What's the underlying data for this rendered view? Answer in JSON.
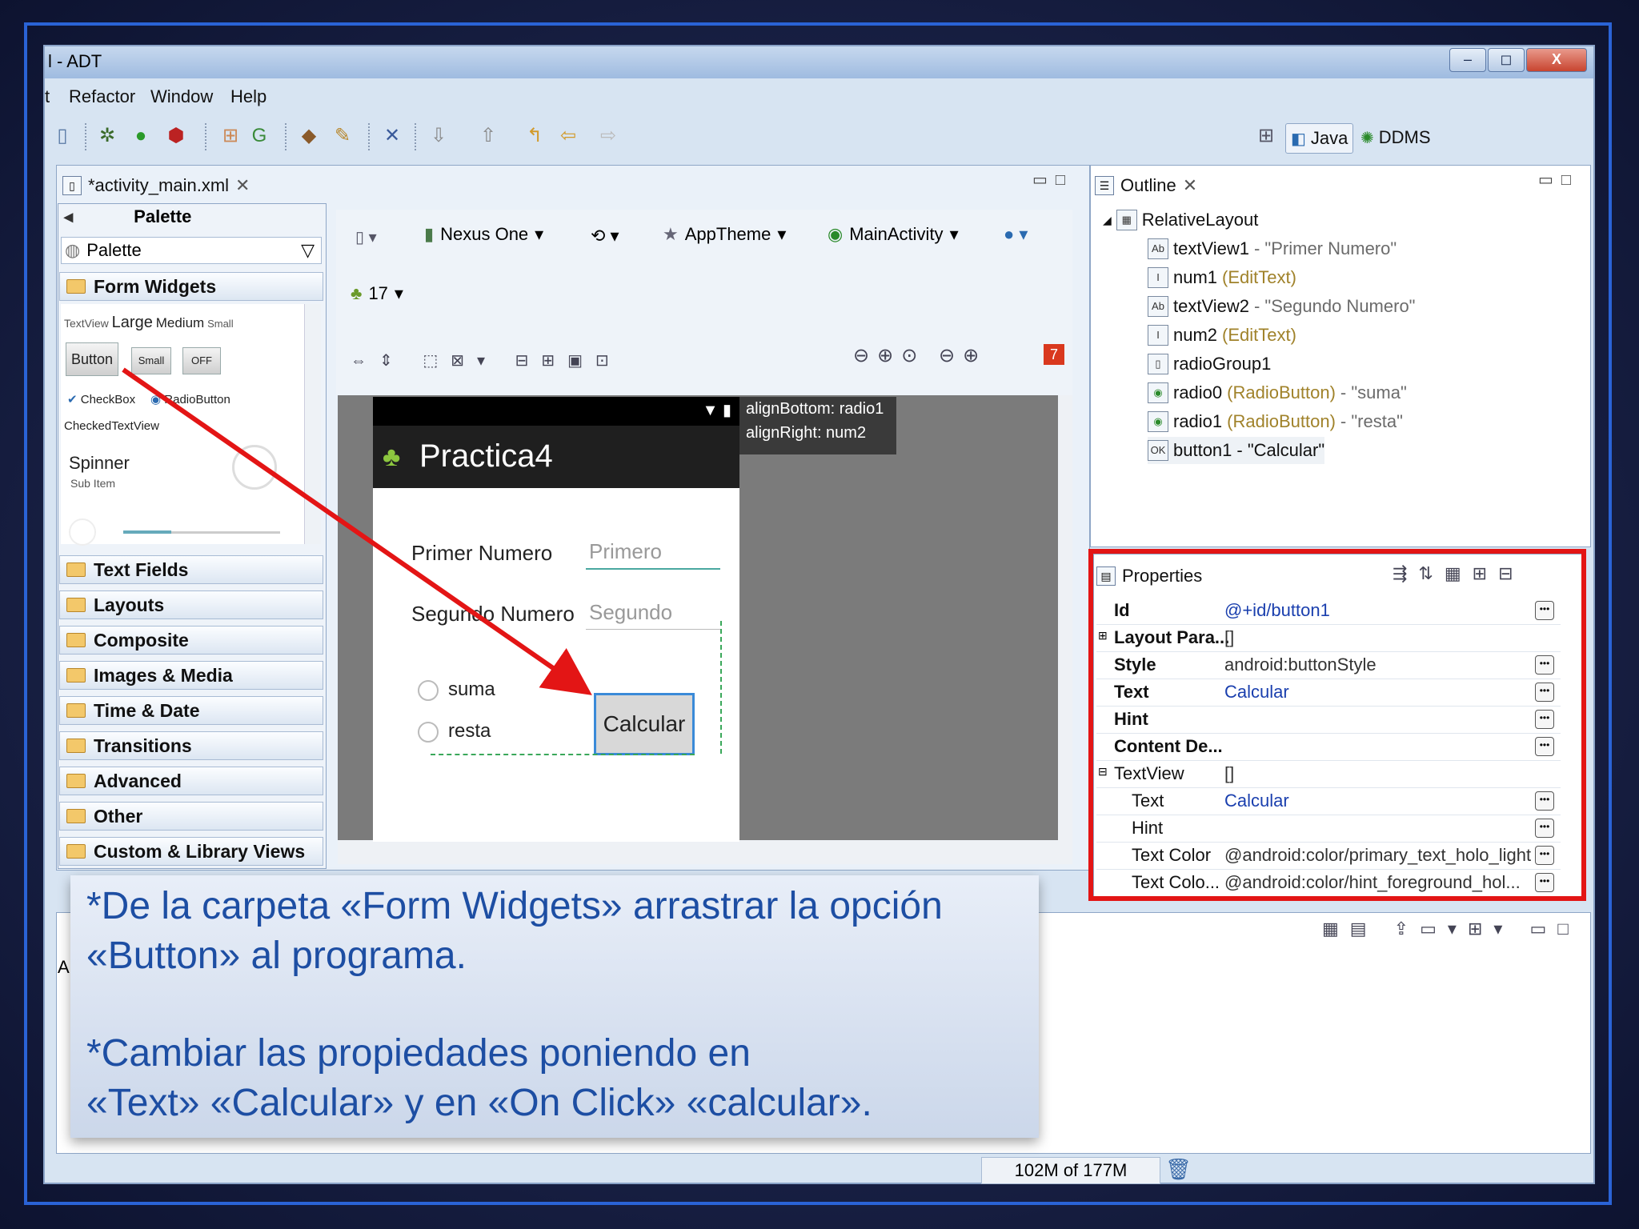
{
  "window": {
    "title": "l - ADT",
    "controls": [
      "–",
      "◻",
      "X"
    ]
  },
  "menu": [
    "t",
    "Refactor",
    "Window",
    "Help"
  ],
  "perspectives": {
    "java": "Java",
    "ddms": "DDMS"
  },
  "editor_tab": "*activity_main.xml",
  "palette": {
    "header": "Palette",
    "dropdown": "Palette",
    "open_section": "Form Widgets",
    "textview_sizes": {
      "tv": "TextView",
      "large": "Large",
      "medium": "Medium",
      "small": "Small"
    },
    "buttons": {
      "button": "Button",
      "small": "Small",
      "off": "OFF"
    },
    "checkbox": "CheckBox",
    "radiobutton": "RadioButton",
    "checkedtextview": "CheckedTextView",
    "spinner": "Spinner",
    "spinner_sub": "Sub Item",
    "sections": [
      "Text Fields",
      "Layouts",
      "Composite",
      "Images & Media",
      "Time & Date",
      "Transitions",
      "Advanced",
      "Other",
      "Custom & Library Views"
    ]
  },
  "layout_toolbar": {
    "device": "Nexus One",
    "theme": "AppTheme",
    "activity": "MainActivity",
    "api": "17",
    "error_count": "7"
  },
  "phone": {
    "app_title": "Practica4",
    "label1": "Primer Numero",
    "hint1": "Primero",
    "label2": "Segundo Numero",
    "hint2": "Segundo",
    "radio1": "suma",
    "radio2": "resta",
    "button": "Calcular"
  },
  "hint_box": [
    "alignBottom: radio1",
    "alignRight: num2"
  ],
  "outline": {
    "tab": "Outline",
    "root": "RelativeLayout",
    "items": [
      {
        "name": "textView1",
        "type": "",
        "text": "- \"Primer Numero\""
      },
      {
        "name": "num1",
        "type": "(EditText)",
        "text": ""
      },
      {
        "name": "textView2",
        "type": "",
        "text": "- \"Segundo Numero\""
      },
      {
        "name": "num2",
        "type": "(EditText)",
        "text": ""
      },
      {
        "name": "radioGroup1",
        "type": "",
        "text": ""
      },
      {
        "name": "radio0",
        "type": "(RadioButton)",
        "text": "- \"suma\""
      },
      {
        "name": "radio1",
        "type": "(RadioButton)",
        "text": "- \"resta\""
      },
      {
        "name": "button1",
        "type": "",
        "text": "- \"Calcular\""
      }
    ]
  },
  "properties": {
    "title": "Properties",
    "rows": [
      {
        "name": "Id",
        "value": "@+id/button1"
      },
      {
        "name": "Layout Para...",
        "value": "[]"
      },
      {
        "name": "Style",
        "value": "android:buttonStyle"
      },
      {
        "name": "Text",
        "value": "Calcular"
      },
      {
        "name": "Hint",
        "value": ""
      },
      {
        "name": "Content De...",
        "value": ""
      },
      {
        "name": "TextView",
        "value": "[]"
      },
      {
        "name": "Text",
        "value": "Calcular"
      },
      {
        "name": "Hint",
        "value": ""
      },
      {
        "name": "Text Color",
        "value": "@android:color/primary_text_holo_light ..."
      },
      {
        "name": "Text Colo...",
        "value": "@android:color/hint_foreground_hol..."
      }
    ]
  },
  "console_prefix": "A",
  "status": {
    "memory": "102M of 177M"
  },
  "instructions": {
    "line1": "*De la carpeta «Form Widgets» arrastrar la opción",
    "line2": "«Button» al programa.",
    "line3": "*Cambiar las propiedades poniendo en",
    "line4": "«Text» «Calcular» y en «On Click» «calcular»."
  },
  "colors": {
    "highlight": "#e31515",
    "instruction_text": "#1d4ea3",
    "frame": "#2a63d6"
  }
}
